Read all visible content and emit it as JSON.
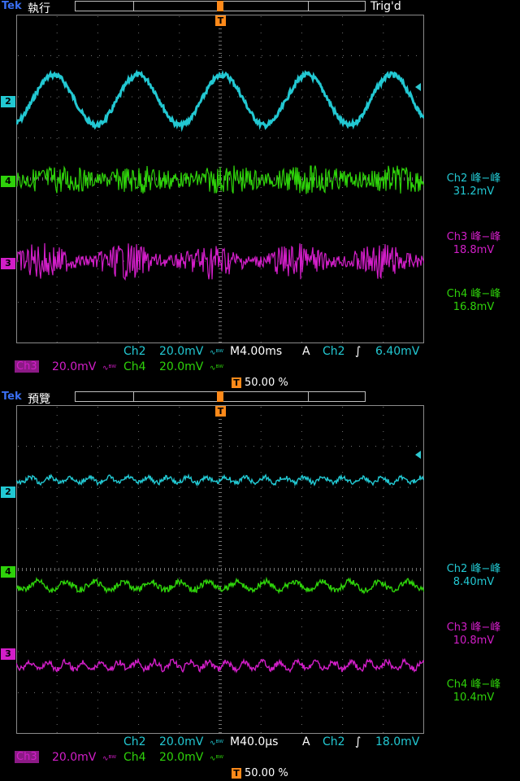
{
  "colors": {
    "ch2": "#22c8d2",
    "ch3": "#d21ec8",
    "ch4": "#2ed20a",
    "trigger": "#ff8a1a",
    "brand": "#3a6ff2"
  },
  "icons": {
    "trigger_marker": "T-box-icon",
    "bandwidth": "bw-limit-icon",
    "edge": "rising-edge-icon"
  },
  "top": {
    "brand": "Tek",
    "mode": "執行",
    "status": "Trig'd",
    "ch_markers": {
      "ch2": "2",
      "ch4": "4",
      "ch3": "3"
    },
    "measurements": [
      {
        "title": "Ch2 峰−峰",
        "value": "31.2mV"
      },
      {
        "title": "Ch3 峰−峰",
        "value": "18.8mV"
      },
      {
        "title": "Ch4 峰−峰",
        "value": "16.8mV"
      }
    ],
    "scale": {
      "ch2": "Ch2",
      "ch2_v": "20.0mV",
      "ch3": "Ch3",
      "ch3_v": "20.0mV",
      "ch4": "Ch4",
      "ch4_v": "20.0mV",
      "timebase": "M4.00ms",
      "trig_mode": "A",
      "trig_src": "Ch2",
      "trig_level": "6.40mV",
      "trig_pos": "50.00 %"
    },
    "t_marker": "T"
  },
  "bottom": {
    "brand": "Tek",
    "mode": "預覽",
    "ch_markers": {
      "ch2": "2",
      "ch4": "4",
      "ch3": "3"
    },
    "measurements": [
      {
        "title": "Ch2 峰−峰",
        "value": "8.40mV"
      },
      {
        "title": "Ch3 峰−峰",
        "value": "10.8mV"
      },
      {
        "title": "Ch4 峰−峰",
        "value": "10.4mV"
      }
    ],
    "scale": {
      "ch2": "Ch2",
      "ch2_v": "20.0mV",
      "ch3": "Ch3",
      "ch3_v": "20.0mV",
      "ch4": "Ch4",
      "ch4_v": "20.0mV",
      "timebase": "M40.0µs",
      "trig_mode": "A",
      "trig_src": "Ch2",
      "trig_level": "18.0mV",
      "trig_pos": "50.00 %"
    },
    "t_marker": "T"
  }
}
